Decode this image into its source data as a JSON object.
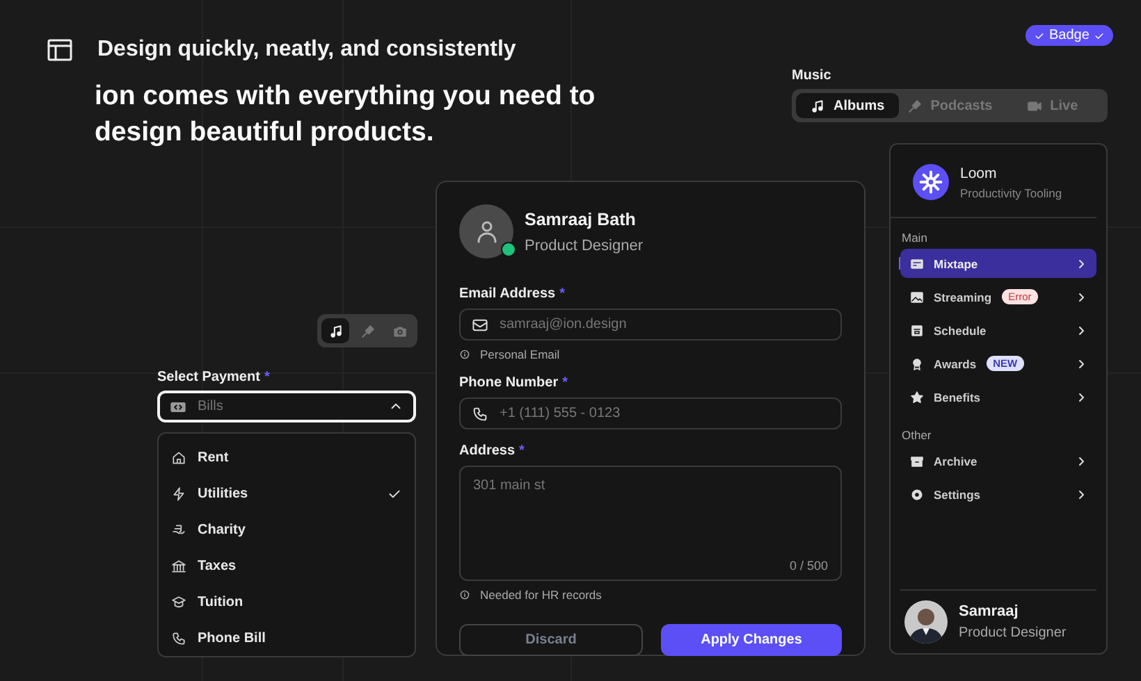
{
  "header": {
    "title": "Design quickly, neatly, and consistently",
    "tagline": "ion comes with everything you need to design beautiful products."
  },
  "badge": {
    "label": "Badge"
  },
  "music": {
    "label": "Music",
    "tabs": [
      {
        "label": "Albums",
        "selected": true
      },
      {
        "label": "Podcasts",
        "selected": false
      },
      {
        "label": "Live",
        "selected": false
      }
    ]
  },
  "icon_toggle": {
    "items": [
      {
        "selected": true
      },
      {
        "selected": false
      },
      {
        "selected": false
      }
    ]
  },
  "payment": {
    "label": "Select Payment",
    "required_mark": "*",
    "placeholder": "Bills",
    "expanded": true,
    "options": [
      {
        "label": "Rent",
        "selected": false
      },
      {
        "label": "Utilities",
        "selected": true
      },
      {
        "label": "Charity",
        "selected": false
      },
      {
        "label": "Taxes",
        "selected": false
      },
      {
        "label": "Tuition",
        "selected": false
      },
      {
        "label": "Phone Bill",
        "selected": false
      }
    ]
  },
  "profile": {
    "name": "Samraaj Bath",
    "role": "Product Designer",
    "online": true,
    "fields": [
      {
        "kind": "input",
        "label": "Email Address",
        "required_mark": "*",
        "placeholder": "samraaj@ion.design",
        "hint": "Personal Email"
      },
      {
        "kind": "input",
        "label": "Phone Number",
        "required_mark": "*",
        "placeholder": "+1 (111) 555 - 0123"
      },
      {
        "kind": "textarea",
        "label": "Address",
        "required_mark": "*",
        "placeholder": "301 main st",
        "counter": "0 / 500",
        "hint": "Needed for HR records"
      }
    ],
    "buttons": [
      {
        "label": "Discard",
        "kind": "secondary"
      },
      {
        "label": "Apply Changes",
        "kind": "primary"
      }
    ]
  },
  "sidebar": {
    "org": {
      "name": "Loom",
      "subtitle": "Productivity Tooling"
    },
    "sections": [
      {
        "title": "Main",
        "items": [
          {
            "label": "Mixtape",
            "selected": true
          },
          {
            "label": "Streaming",
            "selected": false,
            "tag": {
              "label": "Error",
              "kind": "error"
            }
          },
          {
            "label": "Schedule",
            "selected": false
          },
          {
            "label": "Awards",
            "selected": false,
            "tag": {
              "label": "NEW",
              "kind": "new"
            }
          },
          {
            "label": "Benefits",
            "selected": false
          }
        ]
      },
      {
        "title": "Other",
        "items": [
          {
            "label": "Archive",
            "selected": false
          },
          {
            "label": "Settings",
            "selected": false
          }
        ]
      }
    ],
    "user": {
      "name": "Samraaj",
      "role": "Product Designer"
    }
  }
}
